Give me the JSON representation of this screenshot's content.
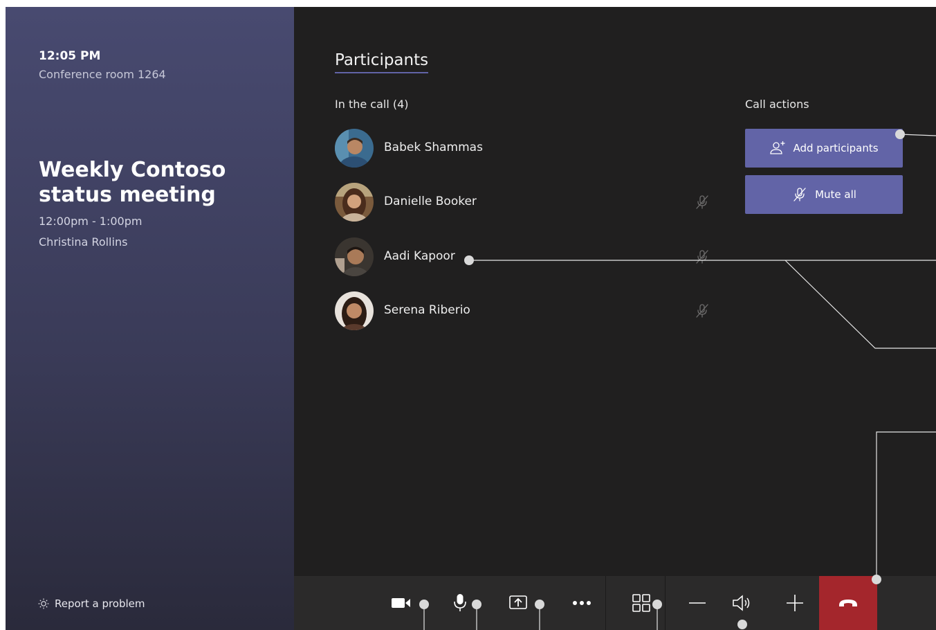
{
  "sidebar": {
    "time": "12:05 PM",
    "room": "Conference room 1264",
    "meeting_title": "Weekly Contoso status meeting",
    "meeting_time": "12:00pm - 1:00pm",
    "organizer": "Christina Rollins",
    "report_label": "Report a problem"
  },
  "main": {
    "tab_title": "Participants",
    "in_call_label": "In the call (4)",
    "participants": [
      {
        "name": "Babek Shammas",
        "muted": false
      },
      {
        "name": "Danielle Booker",
        "muted": true
      },
      {
        "name": "Aadi Kapoor",
        "muted": true
      },
      {
        "name": "Serena Riberio",
        "muted": true
      }
    ],
    "call_actions": {
      "label": "Call actions",
      "add_participants": "Add participants",
      "mute_all": "Mute all"
    }
  },
  "colors": {
    "accent": "#6264a7",
    "hangup": "#a4262c",
    "background": "#201f1f",
    "toolbar": "#2b2a2a"
  },
  "toolbar": {
    "icons": [
      "camera-icon",
      "microphone-icon",
      "share-screen-icon",
      "more-options-icon",
      "layout-icon",
      "volume-down-icon",
      "speaker-icon",
      "volume-up-icon",
      "hang-up-icon"
    ]
  }
}
